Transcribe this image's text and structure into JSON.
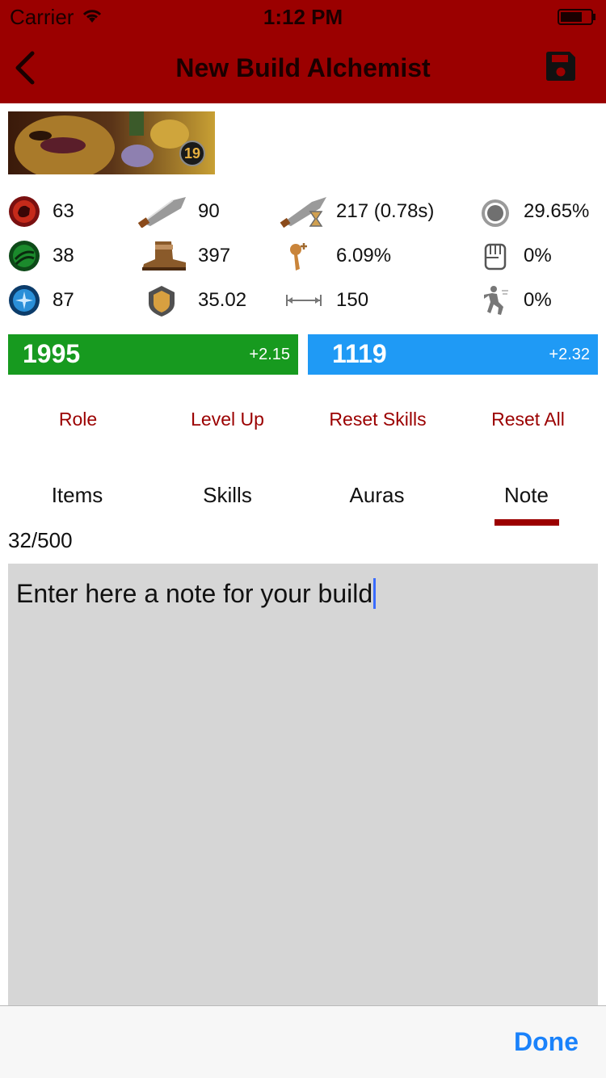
{
  "status_bar": {
    "carrier": "Carrier",
    "time": "1:12 PM"
  },
  "nav": {
    "title": "New Build Alchemist",
    "back_icon": "chevron-left-icon",
    "save_icon": "floppy-disk-icon"
  },
  "hero": {
    "level": "19"
  },
  "stats": {
    "strength": "63",
    "agility": "38",
    "intelligence": "87",
    "damage": "90",
    "move_speed": "397",
    "armor": "35.02",
    "attack_speed": "217 (0.78s)",
    "spell_amp": "6.09%",
    "attack_range": "150",
    "magic_resist": "29.65%",
    "status_resist": "0%",
    "evasion": "0%"
  },
  "health": {
    "value": "1995",
    "regen": "+2.15",
    "color": "#179a1f"
  },
  "mana": {
    "value": "1119",
    "regen": "+2.32",
    "color": "#1f9af5"
  },
  "actions": {
    "role": "Role",
    "level_up": "Level Up",
    "reset_skills": "Reset Skills",
    "reset_all": "Reset All"
  },
  "tabs": [
    "Items",
    "Skills",
    "Auras",
    "Note"
  ],
  "selected_tab": "Note",
  "note": {
    "counter": "32/500",
    "text": "Enter here a note for your build"
  },
  "keyboard_toolbar": {
    "done": "Done"
  },
  "colors": {
    "accent": "#9b0000",
    "link_blue": "#1a82fb"
  }
}
